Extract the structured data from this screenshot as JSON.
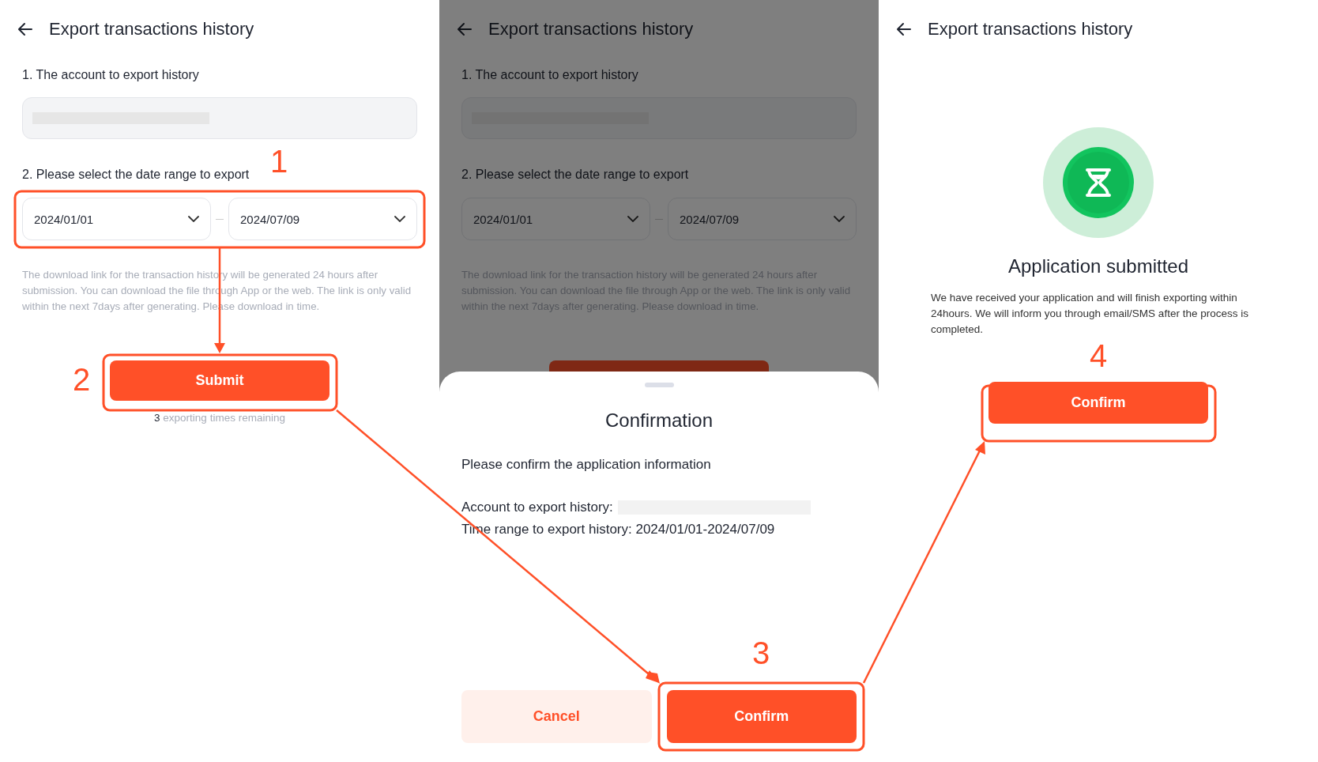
{
  "screens": [
    {
      "title": "Export transactions history",
      "account_label": "1. The account to export history",
      "date_label": "2. Please select the date range to export",
      "start_date": "2024/01/01",
      "end_date": "2024/07/09",
      "note": "The download link for the transaction history will be generated 24 hours after submission. You can download the file through App or the web. The link is only valid within the next 7days after generating. Please download in time.",
      "submit": "Submit",
      "remaining_count": "3",
      "remaining_text": "exporting times remaining"
    },
    {
      "title": "Export transactions history",
      "account_label": "1. The account to export history",
      "date_label": "2. Please select the date range to export",
      "start_date": "2024/01/01",
      "end_date": "2024/07/09",
      "note": "The download link for the transaction history will be generated 24 hours after submission. You can download the file through App or the web. The link is only valid within the next 7days after generating. Please download in time.",
      "sheet": {
        "title": "Confirmation",
        "intro": "Please confirm the application information",
        "account_label": "Account to export history:",
        "range_label": "Time range to export history:",
        "range_value": "2024/01/01-2024/07/09",
        "cancel": "Cancel",
        "confirm": "Confirm"
      }
    },
    {
      "title": "Export transactions history",
      "heading": "Application submitted",
      "message": "We have received your application and will finish exporting within 24hours. We will inform you through email/SMS after the process is completed.",
      "confirm": "Confirm"
    }
  ],
  "annotations": [
    {
      "number": "1"
    },
    {
      "number": "2"
    },
    {
      "number": "3"
    },
    {
      "number": "4"
    }
  ]
}
